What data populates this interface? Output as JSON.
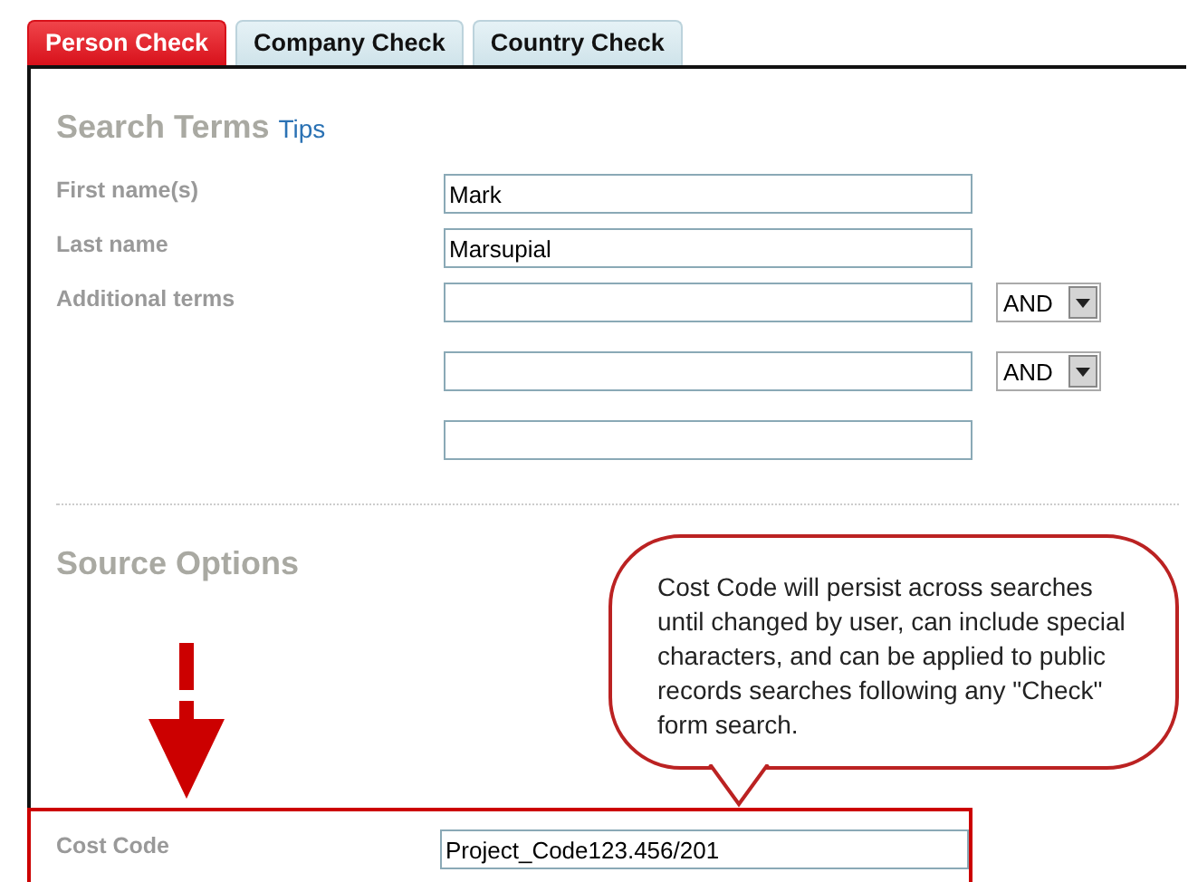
{
  "tabs": [
    {
      "label": "Person Check",
      "selected": true
    },
    {
      "label": "Company Check",
      "selected": false
    },
    {
      "label": "Country Check",
      "selected": false
    }
  ],
  "search_terms": {
    "heading": "Search Terms",
    "tips_link": "Tips",
    "fields": [
      {
        "label": "First name(s)",
        "value": "Mark"
      },
      {
        "label": "Last name",
        "value": "Marsupial"
      }
    ],
    "additional_terms": {
      "label": "Additional terms",
      "inputs": [
        {
          "kind": "with-operator",
          "operator": "AND"
        },
        {
          "kind": "with-operator",
          "operator": "AND"
        },
        {
          "kind": "plain"
        }
      ]
    }
  },
  "source_options": {
    "heading": "Source Options",
    "cost_code": {
      "label": "Cost Code",
      "value": "Project_Code123.456/201"
    }
  },
  "callout": {
    "text": "Cost Code will persist across searches until changed by user, can include special characters, and can be applied to public records searches following any \"Check\" form search."
  }
}
